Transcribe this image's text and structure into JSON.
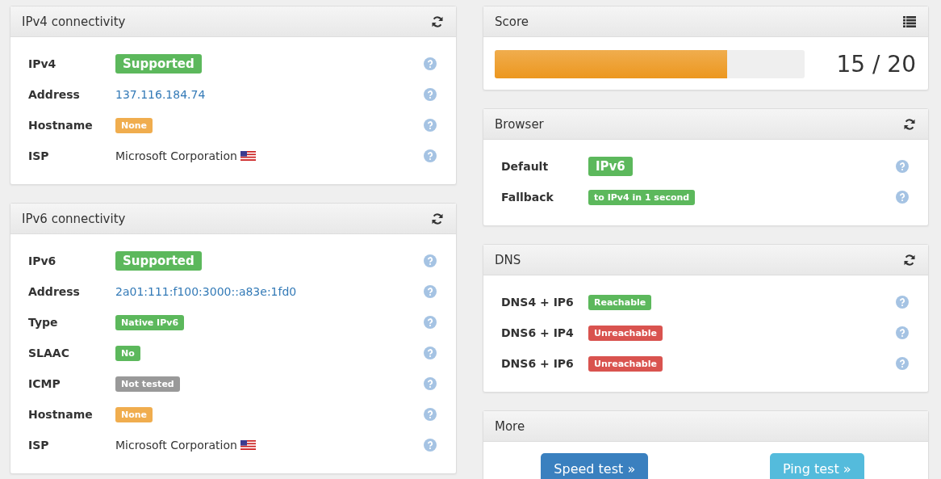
{
  "columns": [
    [
      {
        "title": "IPv4 connectivity",
        "kind": "info",
        "rows": [
          {
            "label": "IPv4",
            "value": "Supported",
            "kind": "big-badge",
            "color": "#5cb85c"
          },
          {
            "label": "Address",
            "value": "137.116.184.74",
            "kind": "link"
          },
          {
            "label": "Hostname",
            "value": "None",
            "kind": "badge",
            "color": "#f0ad4e"
          },
          {
            "label": "ISP",
            "value": "Microsoft Corporation",
            "kind": "flag-text"
          }
        ]
      },
      {
        "title": "IPv6 connectivity",
        "kind": "info",
        "rows": [
          {
            "label": "IPv6",
            "value": "Supported",
            "kind": "big-badge",
            "color": "#5cb85c"
          },
          {
            "label": "Address",
            "value": "2a01:111:f100:3000::a83e:1fd0",
            "kind": "link"
          },
          {
            "label": "Type",
            "value": "Native IPv6",
            "kind": "badge",
            "color": "#5cb85c"
          },
          {
            "label": "SLAAC",
            "value": "No",
            "kind": "badge",
            "color": "#5cb85c"
          },
          {
            "label": "ICMP",
            "value": "Not tested",
            "kind": "badge",
            "color": "#999999"
          },
          {
            "label": "Hostname",
            "value": "None",
            "kind": "badge",
            "color": "#f0ad4e"
          },
          {
            "label": "ISP",
            "value": "Microsoft Corporation",
            "kind": "flag-text"
          }
        ]
      }
    ],
    [
      {
        "title": "Score",
        "kind": "score",
        "level": 0.75,
        "score": "15 / 20"
      },
      {
        "title": "Browser",
        "kind": "info",
        "rows": [
          {
            "label": "Default",
            "value": "IPv6",
            "kind": "big-badge",
            "color": "#5cb85c"
          },
          {
            "label": "Fallback",
            "value": "to IPv4 in 1 second",
            "kind": "badge",
            "color": "#5cb85c"
          }
        ]
      },
      {
        "title": "DNS",
        "kind": "info",
        "rows": [
          {
            "label": "DNS4 + IP6",
            "value": "Reachable",
            "kind": "badge",
            "color": "#5cb85c"
          },
          {
            "label": "DNS6 + IP4",
            "value": "Unreachable",
            "kind": "badge",
            "color": "#d9534f"
          },
          {
            "label": "DNS6 + IP6",
            "value": "Unreachable",
            "kind": "badge",
            "color": "#d9534f"
          }
        ]
      },
      {
        "title": "More",
        "kind": "links",
        "buttons": [
          {
            "label": "Speed test »",
            "color": "#3a80bf"
          },
          {
            "label": "Ping test »",
            "color": "#54bbdc"
          }
        ]
      }
    ]
  ]
}
